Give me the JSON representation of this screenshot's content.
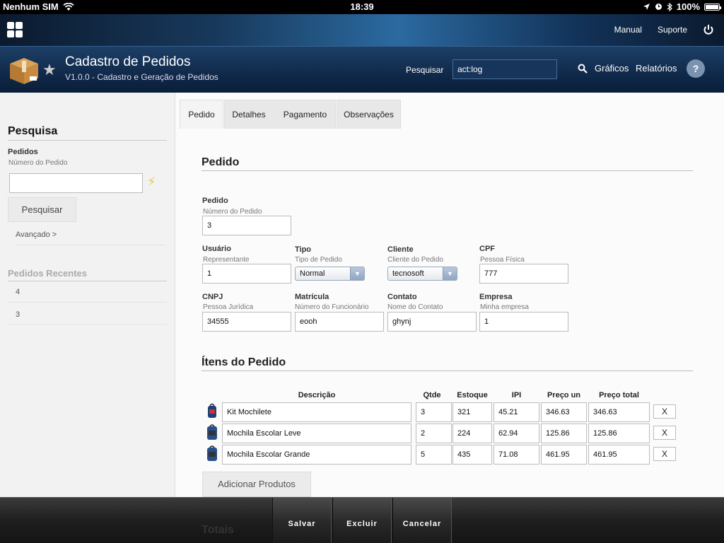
{
  "status_bar": {
    "carrier": "Nenhum SIM",
    "time": "18:39",
    "battery": "100%"
  },
  "top_bar": {
    "manual": "Manual",
    "suporte": "Suporte"
  },
  "header": {
    "title": "Cadastro de Pedidos",
    "subtitle": "V1.0.0 - Cadastro e Geração de Pedidos",
    "search_label": "Pesquisar",
    "search_value": "act:log",
    "graficos": "Gráficos",
    "relatorios": "Relatórios",
    "help": "?"
  },
  "sidebar": {
    "heading": "Pesquisa",
    "pedidos_label": "Pedidos",
    "pedidos_sub": "Número do Pedido",
    "search_button": "Pesquisar",
    "advanced": "Avançado >",
    "recent_heading": "Pedidos Recentes",
    "recent": [
      "4",
      "3"
    ]
  },
  "tabs": [
    "Pedido",
    "Detalhes",
    "Pagamento",
    "Observações"
  ],
  "form": {
    "section_title": "Pedido",
    "pedido": {
      "label": "Pedido",
      "sub": "Número do Pedido",
      "value": "3"
    },
    "usuario": {
      "label": "Usuário",
      "sub": "Representante",
      "value": "1"
    },
    "tipo": {
      "label": "Tipo",
      "sub": "Tipo de Pedido",
      "value": "Normal"
    },
    "cliente": {
      "label": "Cliente",
      "sub": "Cliente do Pedido",
      "value": "tecnosoft"
    },
    "cpf": {
      "label": "CPF",
      "sub": "Pessoa Física",
      "value": "777"
    },
    "cnpj": {
      "label": "CNPJ",
      "sub": "Pessoa Jurídica",
      "value": "34555"
    },
    "matricula": {
      "label": "Matrícula",
      "sub": "Número do Funcionário",
      "value": "eooh"
    },
    "contato": {
      "label": "Contato",
      "sub": "Nome do Contato",
      "value": "ghynj"
    },
    "empresa": {
      "label": "Empresa",
      "sub": "Minha empresa",
      "value": "1"
    }
  },
  "items": {
    "section_title": "Ítens do Pedido",
    "columns": [
      "Descrição",
      "Qtde",
      "Estoque",
      "IPI",
      "Preço un",
      "Preço total"
    ],
    "rows": [
      {
        "descricao": "Kit Mochilete",
        "qtde": "3",
        "estoque": "321",
        "ipi": "45.21",
        "preco_un": "346.63",
        "preco_total": "346.63",
        "remove": "X"
      },
      {
        "descricao": "Mochila Escolar Leve",
        "qtde": "2",
        "estoque": "224",
        "ipi": "62.94",
        "preco_un": "125.86",
        "preco_total": "125.86",
        "remove": "X"
      },
      {
        "descricao": "Mochila Escolar Grande",
        "qtde": "5",
        "estoque": "435",
        "ipi": "71.08",
        "preco_un": "461.95",
        "preco_total": "461.95",
        "remove": "X"
      }
    ],
    "add_button": "Adicionar Produtos"
  },
  "totais_title": "Totais",
  "bottom_bar": {
    "salvar": "Salvar",
    "excluir": "Excluir",
    "cancelar": "Cancelar"
  }
}
